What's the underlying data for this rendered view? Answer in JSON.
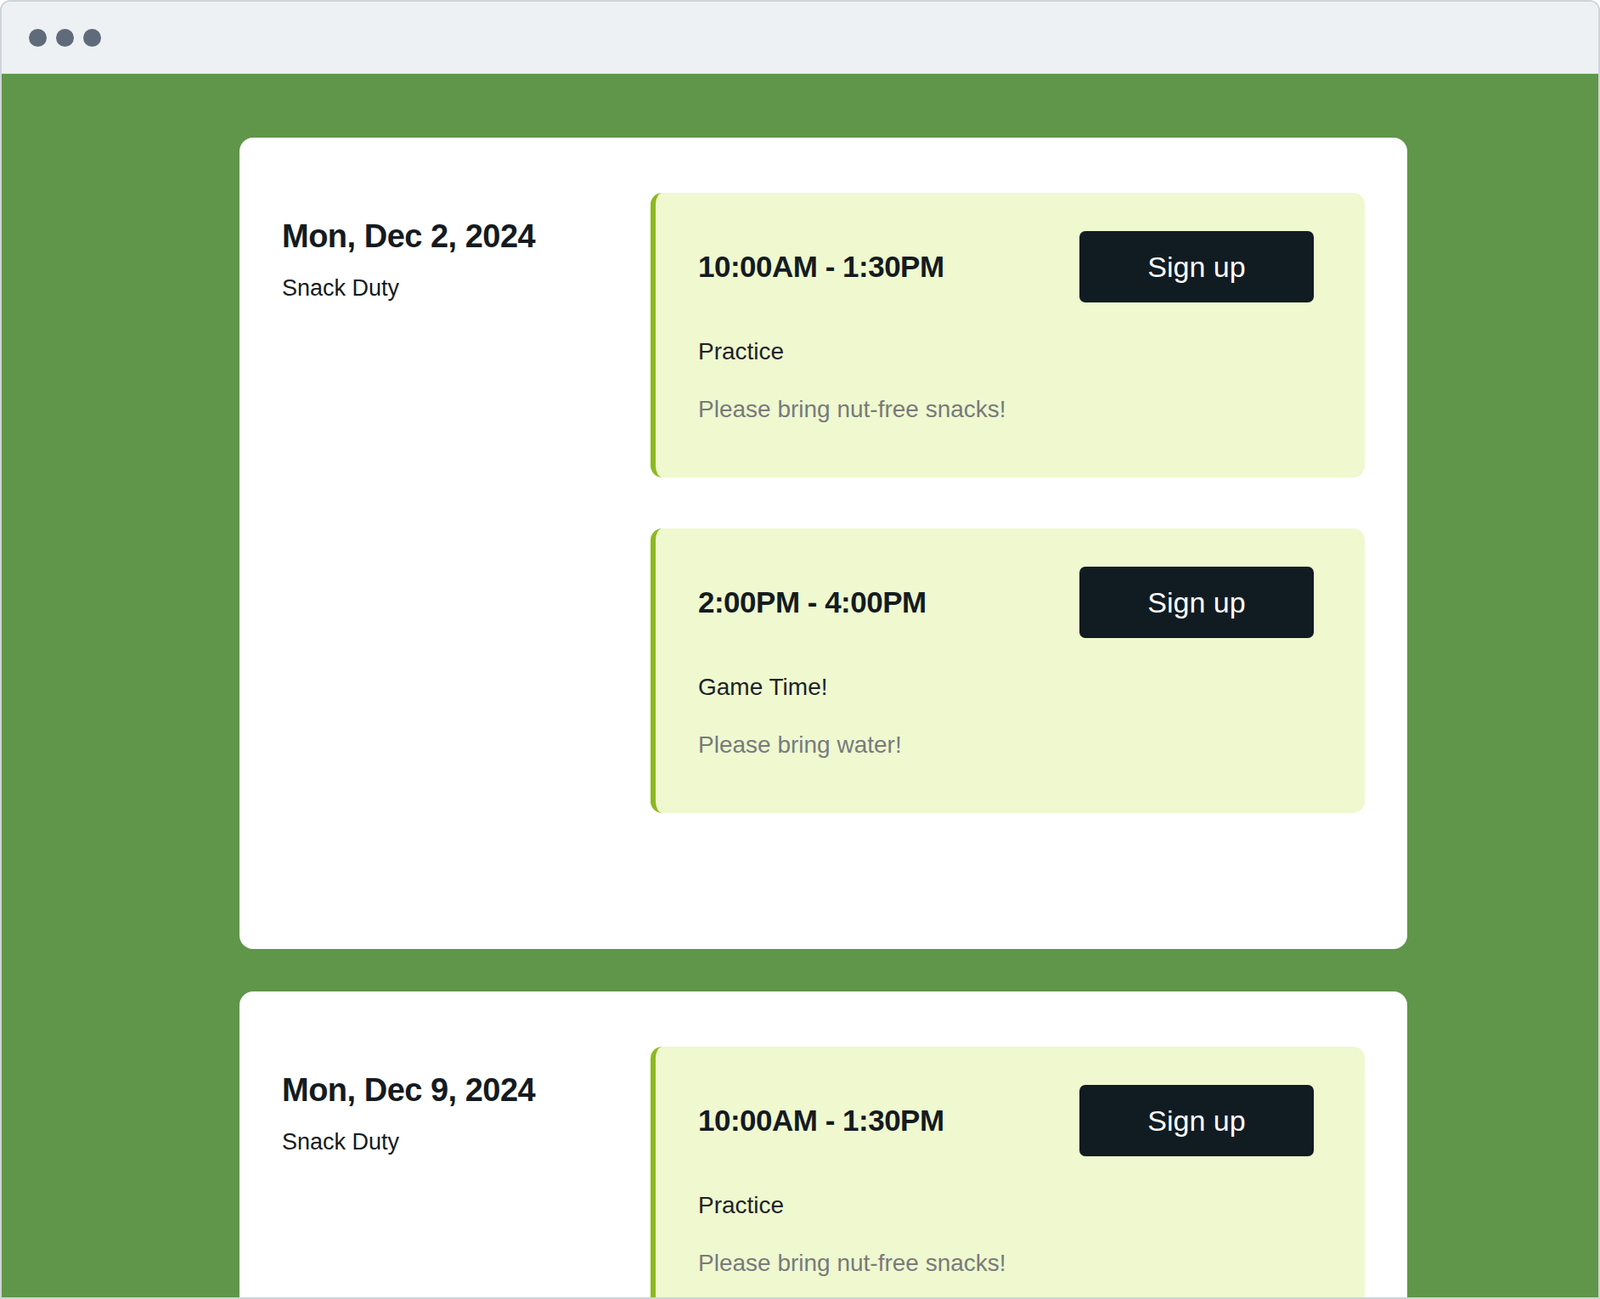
{
  "events": [
    {
      "date": "Mon, Dec 2, 2024",
      "title": "Snack Duty",
      "slots": [
        {
          "time": "10:00AM - 1:30PM",
          "button": "Sign up",
          "label": "Practice",
          "note": "Please bring nut-free snacks!"
        },
        {
          "time": "2:00PM - 4:00PM",
          "button": "Sign up",
          "label": "Game Time!",
          "note": "Please bring water!"
        }
      ]
    },
    {
      "date": "Mon, Dec 9, 2024",
      "title": "Snack Duty",
      "slots": [
        {
          "time": "10:00AM - 1:30PM",
          "button": "Sign up",
          "label": "Practice",
          "note": "Please bring nut-free snacks!"
        }
      ]
    }
  ]
}
